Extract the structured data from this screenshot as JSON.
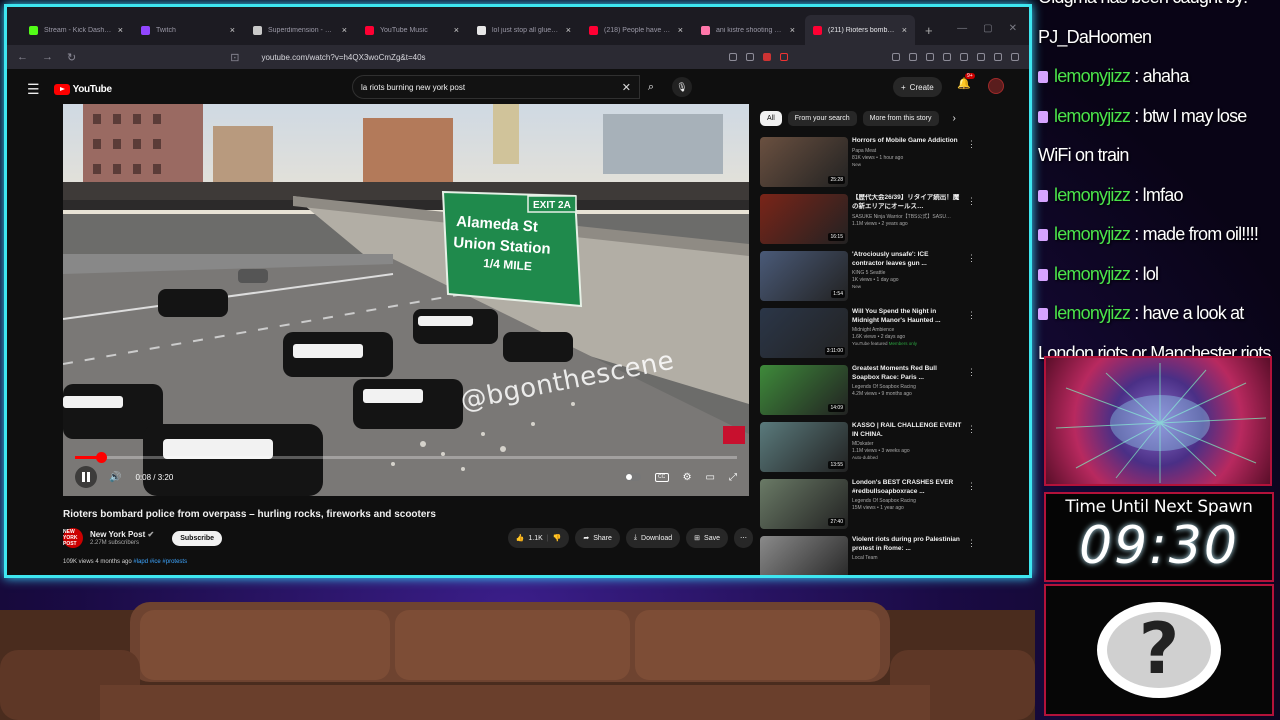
{
  "browser": {
    "tabs": [
      {
        "title": "Stream - Kick Dashboard",
        "color": "#53fc18",
        "active": false
      },
      {
        "title": "Twitch",
        "color": "#9146ff",
        "active": false
      },
      {
        "title": "Superdimension - Free Download",
        "color": "#c9c9c9",
        "active": false
      },
      {
        "title": "YouTube Music",
        "color": "#ff0033",
        "active": false
      },
      {
        "title": "lol just stop all glued hands",
        "color": "#e7e7e7",
        "active": false
      },
      {
        "title": "(218) People have found electr",
        "color": "#ff0033",
        "active": false
      },
      {
        "title": "ani kistre shooting meme ver",
        "color": "#ff77aa",
        "active": false
      },
      {
        "title": "(211) Rioters bombard po",
        "color": "#ff0033",
        "active": true
      }
    ],
    "new_tab": "+",
    "url": "youtube.com/watch?v=h4QX3woCmZg&t=40s"
  },
  "youtube": {
    "logo_text": "YouTube",
    "search": {
      "value": "la riots burning new york post"
    },
    "create_label": "Create",
    "notif_count": "9+",
    "video": {
      "watermark": "@bgonthescene",
      "sign_exit": "EXIT 2A",
      "sign_lines": [
        "Alameda St",
        "Union Station",
        "1/4 MILE"
      ],
      "time": "0:08 / 3:20",
      "progress": 0.04,
      "title": "Rioters bombard police from overpass – hurling rocks, fireworks and scooters"
    },
    "channel": {
      "name": "New York Post",
      "subs": "2.27M subscribers",
      "avatar_text": "NEW YORK POST",
      "subscribe": "Subscribe"
    },
    "actions": {
      "likes": "1.1K",
      "share": "Share",
      "download": "Download",
      "save": "Save"
    },
    "desc": {
      "meta": "109K views  4 months ago",
      "tags": "#lapd #ice #protests"
    },
    "chips": [
      "All",
      "From your search",
      "More from this story"
    ],
    "recs": [
      {
        "title": "Horrors of Mobile Game Addiction",
        "channel": "Papa Meat",
        "meta": "81K views • 1 hour ago",
        "badge": "New",
        "duration": "25:28",
        "thumb": "#6a5040"
      },
      {
        "title": "【歴代大会26/39】リタイア続出！魔の新エリアにオールス…",
        "channel": "SASUKE Ninja Warrior【TBS公式】SASU…",
        "meta": "1.1M views • 2 years ago",
        "badge": "",
        "duration": "16:15",
        "thumb": "#7a2418"
      },
      {
        "title": "'Atrociously unsafe': ICE contractor leaves gun ...",
        "channel": "KING 5 Seattle",
        "meta": "1K views • 1 day ago",
        "badge": "New",
        "duration": "1:54",
        "thumb": "#4a5a78"
      },
      {
        "title": "Will You Spend the Night in Midnight Manor's Haunted ...",
        "channel": "Midnight Ambience",
        "meta": "1.6K views • 2 days ago",
        "badge": "YouTube featured",
        "member": "Members only",
        "duration": "3:11:00",
        "thumb": "#2b3648"
      },
      {
        "title": "Greatest Moments Red Bull Soapbox Race: Paris ...",
        "channel": "Legends Of Soapbox Racing",
        "meta": "4.2M views • 9 months ago",
        "badge": "",
        "duration": "14:09",
        "thumb": "#3e8a3a"
      },
      {
        "title": "KASSO | RAIL CHALLENGE EVENT IN CHINA.",
        "channel": "MDskater",
        "meta": "1.1M views • 3 weeks ago",
        "badge": "Auto-dubbed",
        "duration": "13:55",
        "thumb": "#5a7a7c"
      },
      {
        "title": "London's BEST CRASHES EVER #redbullsoapboxrace ...",
        "channel": "Legends Of Soapbox Racing",
        "meta": "15M views • 1 year ago",
        "badge": "",
        "duration": "27:40",
        "thumb": "#6a7a66"
      },
      {
        "title": "Violent riots during pro Palestinian protest in Rome: ...",
        "channel": "Local Team",
        "meta": "",
        "badge": "",
        "duration": "",
        "thumb": "#8a8a8a"
      }
    ]
  },
  "overlay": {
    "chat": [
      {
        "name": "",
        "text": "Oldgma has been caught by:"
      },
      {
        "name": "",
        "text": "PJ_DaHoomen"
      },
      {
        "name": "lemonyjizz",
        "text": " : ahaha"
      },
      {
        "name": "lemonyjizz",
        "text": " : btw I may lose"
      },
      {
        "name": "",
        "text": "WiFi on train"
      },
      {
        "name": "lemonyjizz",
        "text": " : lmfao"
      },
      {
        "name": "lemonyjizz",
        "text": " : made from oil!!!!"
      },
      {
        "name": "lemonyjizz",
        "text": " : lol"
      },
      {
        "name": "lemonyjizz",
        "text": " : have a look at"
      },
      {
        "name": "",
        "text": "London riots or Manchester riots"
      }
    ],
    "spawn_label": "Time Until Next Spawn",
    "spawn_timer": "09:30",
    "mystery_glyph": "?"
  },
  "colors": {
    "frame": "#3ee6f0",
    "accent_red": "#ff0000",
    "chat_name": "#4be34b"
  }
}
